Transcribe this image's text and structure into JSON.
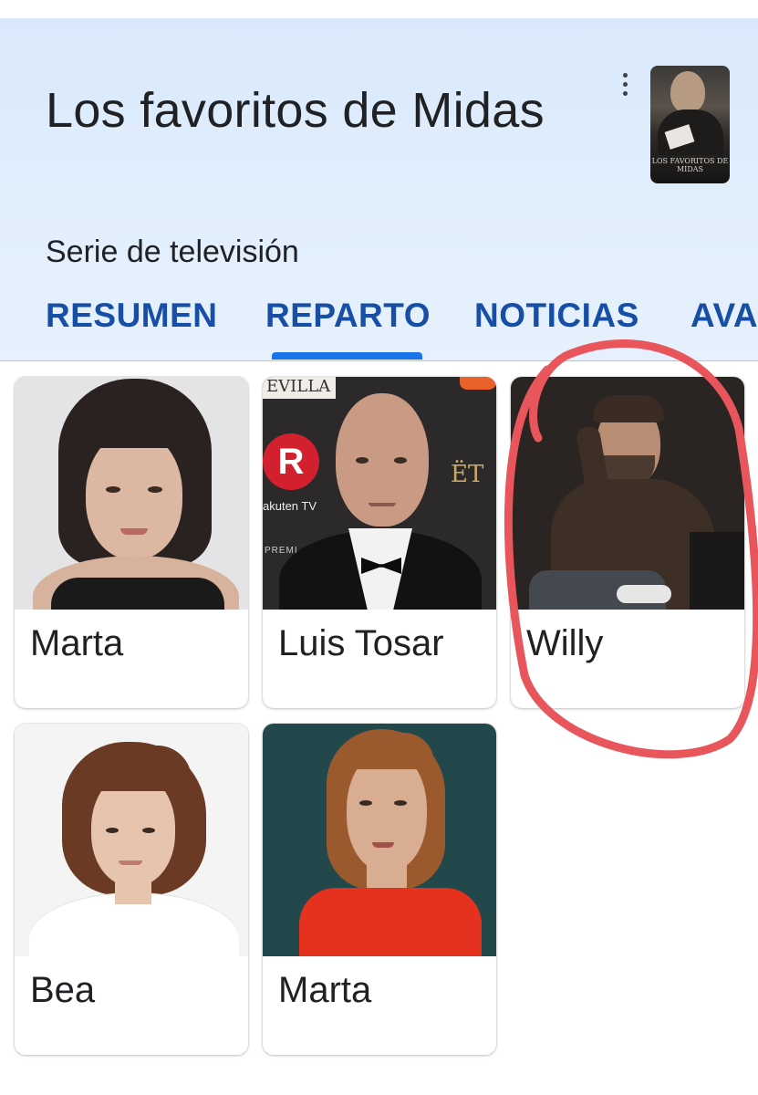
{
  "header": {
    "title": "Los favoritos de Midas",
    "subtitle": "Serie de televisión",
    "poster_logo": "LOS FAVORITOS DE MIDAS"
  },
  "tabs": [
    {
      "label": "RESUMEN",
      "selected": false
    },
    {
      "label": "REPARTO",
      "selected": true
    },
    {
      "label": "NOTICIAS",
      "selected": false
    },
    {
      "label": "AVA",
      "selected": false
    }
  ],
  "cast": [
    {
      "name": "Marta"
    },
    {
      "name": "Luis Tosar"
    },
    {
      "name": "Willy"
    },
    {
      "name": "Bea"
    },
    {
      "name": "Marta"
    }
  ],
  "photo_backdrop_text": {
    "sevilla": "EVILLA",
    "rakuten_logo": "R",
    "rakuten_text": "akuten TV",
    "premios": "PREMI",
    "goya": "ËT"
  },
  "colors": {
    "header_background": "#dceafb",
    "tab_text": "#174ea6",
    "tab_indicator": "#1a73e8",
    "annotation": "#e8565c"
  }
}
